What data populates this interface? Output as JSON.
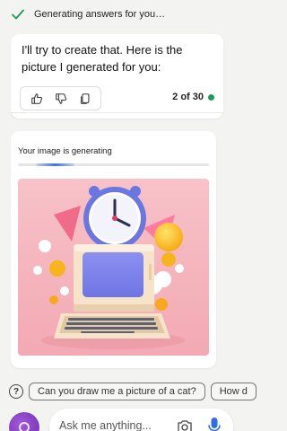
{
  "status": {
    "text": "Generating answers for you…"
  },
  "answer": {
    "text": "I'll try to create that. Here is the picture I generated for you:",
    "counter": "2 of 30"
  },
  "feedback": {
    "icons": [
      "thumbs-up-icon",
      "thumbs-down-icon",
      "copy-icon"
    ]
  },
  "image_card": {
    "label": "Your image is generating",
    "progress": 0.2
  },
  "suggestions": {
    "chips": [
      "Can you draw me a picture of a cat?",
      "How d"
    ]
  },
  "composer": {
    "placeholder": "Ask me anything..."
  },
  "colors": {
    "accent": "#1a9b57",
    "mic": "#2e6ee6",
    "progress": "#3d73e8"
  }
}
